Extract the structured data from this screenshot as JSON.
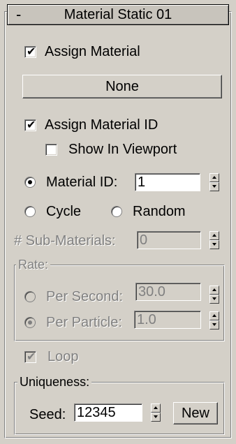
{
  "rollout": {
    "toggle": "-",
    "title": "Material Static 01"
  },
  "assign_material": {
    "label": "Assign Material",
    "checked": true,
    "button_label": "None"
  },
  "assign_material_id": {
    "label": "Assign Material ID",
    "checked": true
  },
  "show_in_viewport": {
    "label": "Show In Viewport",
    "checked": false
  },
  "material_id": {
    "label": "Material ID:",
    "value": "1",
    "selected": true
  },
  "cycle": {
    "label": "Cycle",
    "selected": false
  },
  "random": {
    "label": "Random",
    "selected": false
  },
  "sub_materials": {
    "label": "# Sub-Materials:",
    "value": "0"
  },
  "rate": {
    "group_label": "Rate:",
    "per_second": {
      "label": "Per Second:",
      "value": "30.0",
      "selected": false
    },
    "per_particle": {
      "label": "Per Particle:",
      "value": "1.0",
      "selected": true
    }
  },
  "loop": {
    "label": "Loop",
    "checked": true
  },
  "uniqueness": {
    "group_label": "Uniqueness:",
    "seed_label": "Seed:",
    "seed_value": "12345",
    "new_button": "New"
  }
}
